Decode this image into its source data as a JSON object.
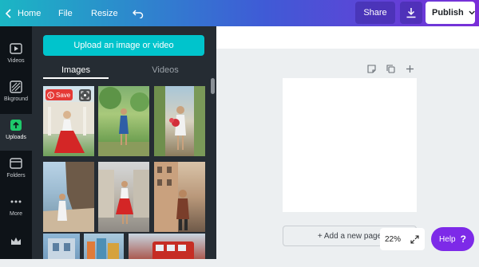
{
  "topbar": {
    "home_label": "Home",
    "file_label": "File",
    "resize_label": "Resize",
    "share_label": "Share",
    "publish_label": "Publish"
  },
  "sidebar": {
    "items": [
      {
        "label": "Videos",
        "icon": "video-icon"
      },
      {
        "label": "Bkground",
        "icon": "background-icon"
      },
      {
        "label": "Uploads",
        "icon": "upload-cloud-icon",
        "active": true
      },
      {
        "label": "Folders",
        "icon": "folder-icon"
      },
      {
        "label": "More",
        "icon": "more-dots-icon"
      },
      {
        "label": "",
        "icon": "crown-icon"
      }
    ]
  },
  "panel": {
    "upload_button": "Upload an image or video",
    "tabs": [
      {
        "label": "Images",
        "active": true
      },
      {
        "label": "Videos",
        "active": false
      }
    ],
    "save_badge": "Save"
  },
  "canvas": {
    "add_page_label": "+ Add a new page",
    "zoom_label": "22%"
  },
  "help": {
    "label": "Help",
    "glyph": "?"
  },
  "colors": {
    "accent_teal": "#00c4cc",
    "help_purple": "#7d2ae8",
    "panel_dark": "#252c33",
    "save_red": "#e53935"
  }
}
